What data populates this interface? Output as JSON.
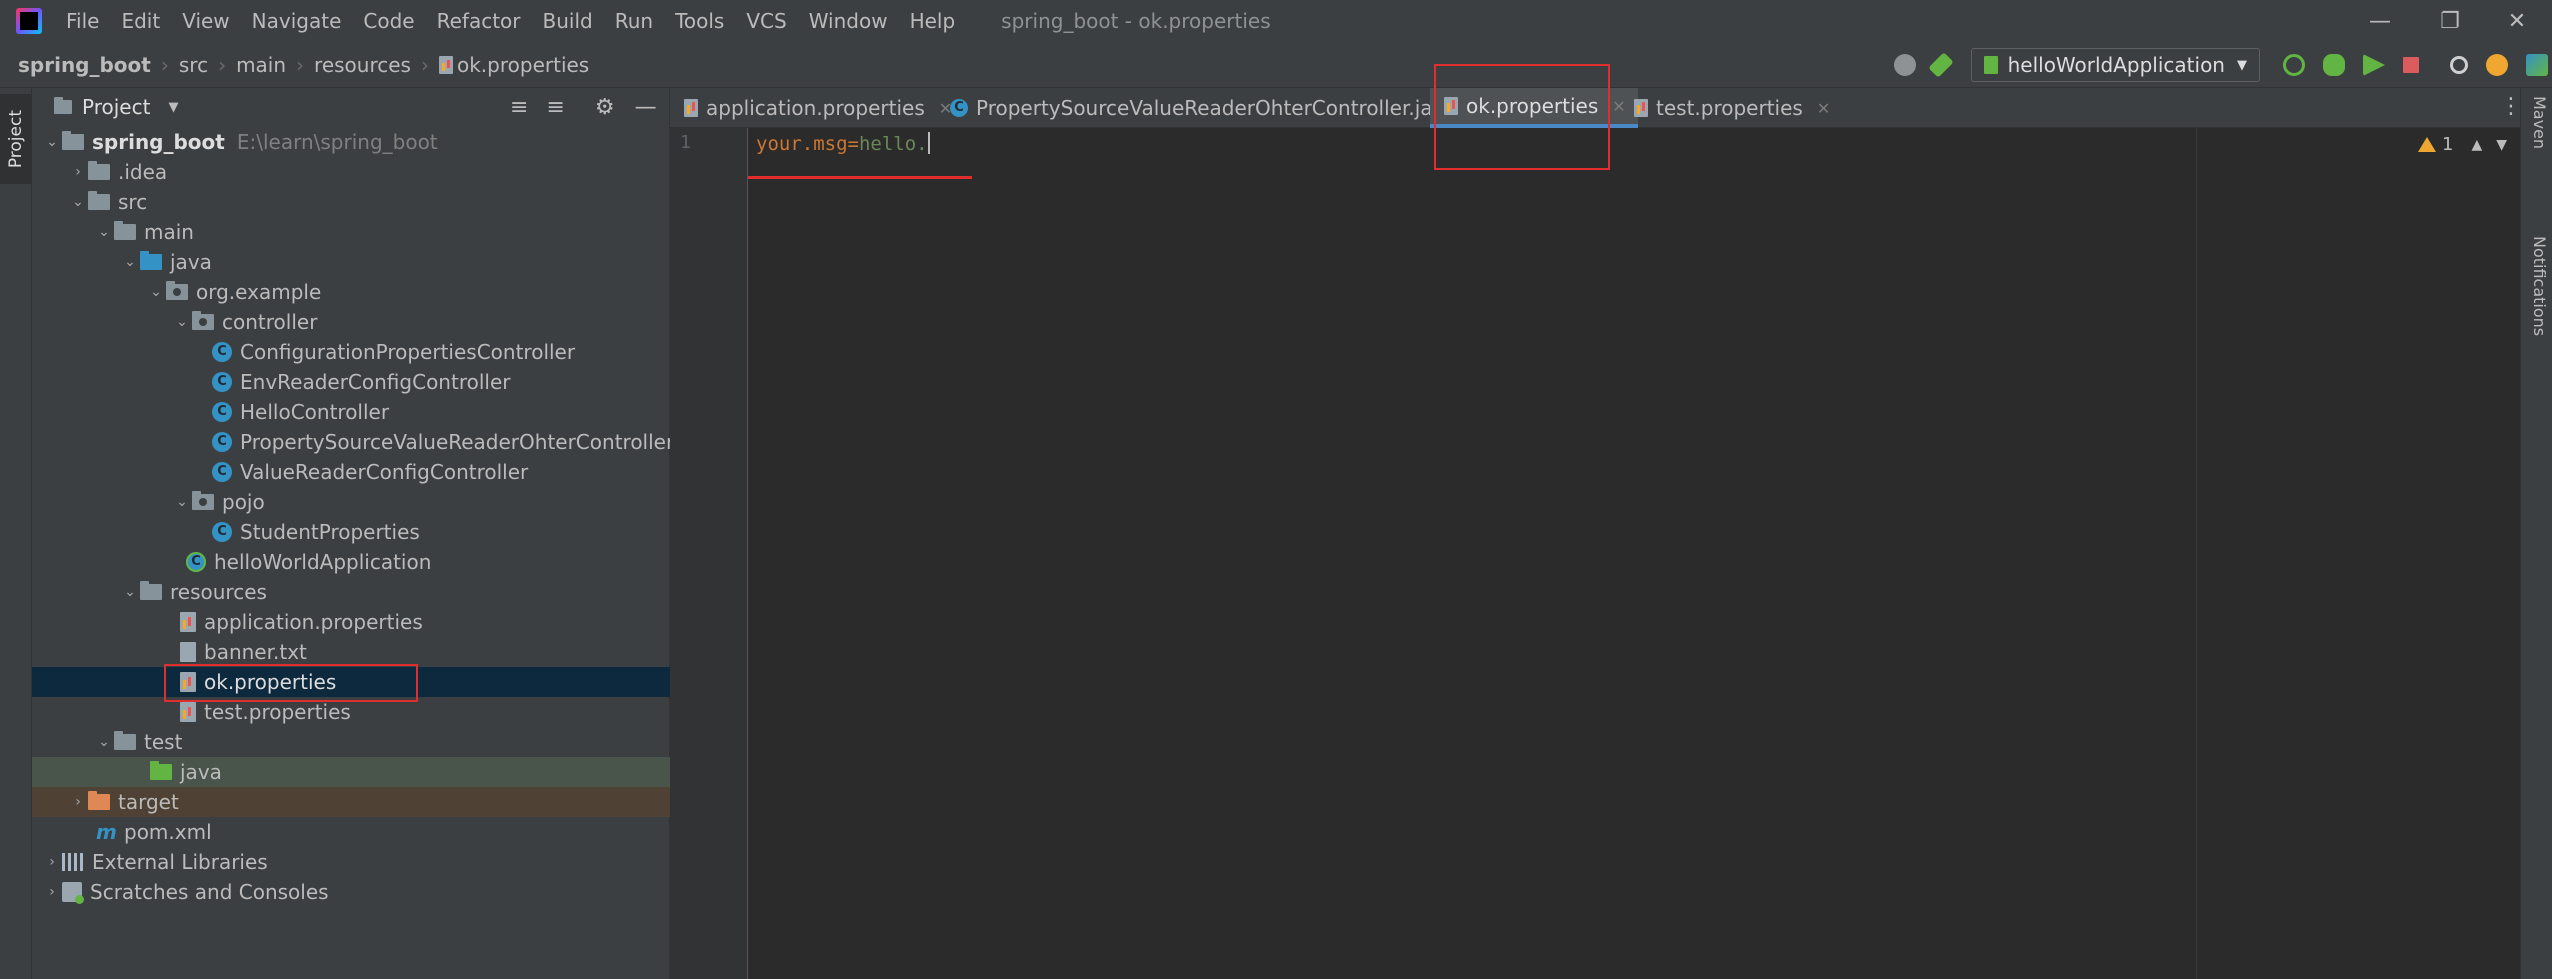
{
  "window": {
    "title": "spring_boot - ok.properties",
    "menu": [
      "File",
      "Edit",
      "View",
      "Navigate",
      "Code",
      "Refactor",
      "Build",
      "Run",
      "Tools",
      "VCS",
      "Window",
      "Help"
    ]
  },
  "breadcrumb": [
    "spring_boot",
    "src",
    "main",
    "resources",
    "ok.properties"
  ],
  "toolbar": {
    "run_config": "helloWorldApplication"
  },
  "left_stripe": {
    "project_tab": "Project"
  },
  "project_panel": {
    "title": "Project",
    "tree": {
      "root": {
        "label": "spring_boot",
        "path": "E:\\learn\\spring_boot"
      },
      "idea": ".idea",
      "src": "src",
      "main": "main",
      "java": "java",
      "package": "org.example",
      "controller": "controller",
      "classes": [
        "ConfigurationPropertiesController",
        "EnvReaderConfigController",
        "HelloController",
        "PropertySourceValueReaderOhterController",
        "ValueReaderConfigController"
      ],
      "pojo": "pojo",
      "pojo_class": "StudentProperties",
      "app_class": "helloWorldApplication",
      "resources": "resources",
      "resource_files": [
        "application.properties",
        "banner.txt",
        "ok.properties",
        "test.properties"
      ],
      "test": "test",
      "test_java": "java",
      "target": "target",
      "pom": "pom.xml",
      "external_libraries": "External Libraries",
      "scratches": "Scratches and Consoles"
    }
  },
  "editor": {
    "tabs": [
      {
        "label": "application.properties",
        "active": false
      },
      {
        "label": "PropertySourceValueReaderOhterController.java",
        "active": false
      },
      {
        "label": "ok.properties",
        "active": true
      },
      {
        "label": "test.properties",
        "active": false
      }
    ],
    "lines": [
      {
        "number": "1",
        "key": "your.msg",
        "value": "hello."
      }
    ],
    "warning_count": "1"
  },
  "right_stripe": {
    "maven": "Maven",
    "notifications": "Notifications"
  },
  "colors": {
    "accent": "#4a88c7",
    "annotation": "#e02e2e",
    "selection": "#0d293e"
  }
}
